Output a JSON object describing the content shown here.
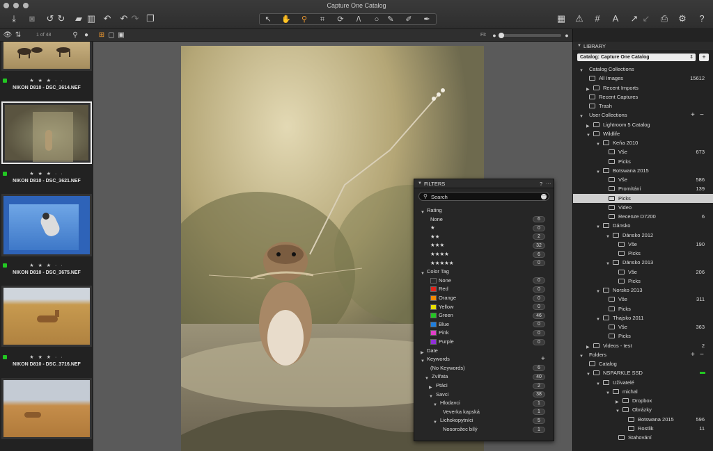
{
  "window": {
    "title": "Capture One Catalog"
  },
  "toolbar": {
    "fit_label": "Fit"
  },
  "browser": {
    "counter": "1 of 48",
    "thumbs": [
      {
        "stars": "★ ★ ★ · ·",
        "filename": "NIKON D810 - DSC_3614.NEF",
        "green": true
      },
      {
        "stars": "★ ★ ★ · ·",
        "filename": "NIKON D810 - DSC_3621.NEF",
        "green": true
      },
      {
        "stars": "★ ★ ★ · ·",
        "filename": "NIKON D810 - DSC_3675.NEF",
        "green": true
      },
      {
        "stars": "★ ★ ★ · ·",
        "filename": "NIKON D810 - DSC_3716.NEF",
        "green": true
      }
    ]
  },
  "filters": {
    "title": "FILTERS",
    "help": "?",
    "more": "···",
    "search_placeholder": "Search",
    "rating_header": "Rating",
    "ratings": [
      {
        "label": "None",
        "count": "6"
      },
      {
        "label": "★",
        "count": "0"
      },
      {
        "label": "★★",
        "count": "2"
      },
      {
        "label": "★★★",
        "count": "32"
      },
      {
        "label": "★★★★",
        "count": "6"
      },
      {
        "label": "★★★★★",
        "count": "0"
      }
    ],
    "colortag_header": "Color Tag",
    "colortags": [
      {
        "label": "None",
        "count": "0",
        "color": "#2a2a2a"
      },
      {
        "label": "Red",
        "count": "0",
        "color": "#e0241c"
      },
      {
        "label": "Orange",
        "count": "0",
        "color": "#f08a00"
      },
      {
        "label": "Yellow",
        "count": "0",
        "color": "#e8e000"
      },
      {
        "label": "Green",
        "count": "46",
        "color": "#22c822"
      },
      {
        "label": "Blue",
        "count": "0",
        "color": "#1e7fe0"
      },
      {
        "label": "Pink",
        "count": "0",
        "color": "#e040c8"
      },
      {
        "label": "Purple",
        "count": "0",
        "color": "#9030d8"
      }
    ],
    "date_header": "Date",
    "keywords_header": "Keywords",
    "keywords": [
      {
        "label": "(No Keywords)",
        "count": "6",
        "indent": 0,
        "arrow": ""
      },
      {
        "label": "Zvířata",
        "count": "40",
        "indent": 0,
        "arrow": "▼"
      },
      {
        "label": "Ptáci",
        "count": "2",
        "indent": 1,
        "arrow": "▶"
      },
      {
        "label": "Savci",
        "count": "38",
        "indent": 1,
        "arrow": "▼"
      },
      {
        "label": "Hlodavci",
        "count": "1",
        "indent": 2,
        "arrow": "▼"
      },
      {
        "label": "Veverka kapská",
        "count": "1",
        "indent": 3,
        "arrow": ""
      },
      {
        "label": "Lichokopytníci",
        "count": "5",
        "indent": 2,
        "arrow": "▼"
      },
      {
        "label": "Nosorožec bílý",
        "count": "1",
        "indent": 3,
        "arrow": ""
      }
    ]
  },
  "library": {
    "title": "LIBRARY",
    "catalog_select": "Catalog: Capture One Catalog",
    "add": "+",
    "rows": [
      {
        "label": "Catalog Collections",
        "indent": 0,
        "arrow": "▼",
        "count": "",
        "icon": false,
        "sel": false
      },
      {
        "label": "All Images",
        "indent": 1,
        "arrow": "",
        "count": "15612",
        "icon": true,
        "sel": false
      },
      {
        "label": "Recent Imports",
        "indent": 1,
        "arrow": "▶",
        "count": "",
        "icon": true,
        "sel": false
      },
      {
        "label": "Recent Captures",
        "indent": 1,
        "arrow": "",
        "count": "",
        "icon": true,
        "sel": false
      },
      {
        "label": "Trash",
        "indent": 1,
        "arrow": "",
        "count": "",
        "icon": true,
        "sel": false
      },
      {
        "label": "User Collections",
        "indent": 0,
        "arrow": "▼",
        "count": "",
        "icon": false,
        "sel": false,
        "plusminus": true
      },
      {
        "label": "Lightroom 5 Catalog",
        "indent": 1,
        "arrow": "▶",
        "count": "",
        "icon": true,
        "sel": false
      },
      {
        "label": "Wildlife",
        "indent": 1,
        "arrow": "▼",
        "count": "",
        "icon": true,
        "sel": false
      },
      {
        "label": "Keňa 2010",
        "indent": 2,
        "arrow": "▼",
        "count": "",
        "icon": true,
        "sel": false
      },
      {
        "label": "Vše",
        "indent": 3,
        "arrow": "",
        "count": "673",
        "icon": true,
        "sel": false
      },
      {
        "label": "Picks",
        "indent": 3,
        "arrow": "",
        "count": "",
        "icon": true,
        "sel": false
      },
      {
        "label": "Botswana 2015",
        "indent": 2,
        "arrow": "▼",
        "count": "",
        "icon": true,
        "sel": false
      },
      {
        "label": "Vše",
        "indent": 3,
        "arrow": "",
        "count": "586",
        "icon": true,
        "sel": false
      },
      {
        "label": "Promítání",
        "indent": 3,
        "arrow": "",
        "count": "139",
        "icon": true,
        "sel": false
      },
      {
        "label": "Picks",
        "indent": 3,
        "arrow": "",
        "count": "",
        "icon": true,
        "sel": true
      },
      {
        "label": "Video",
        "indent": 3,
        "arrow": "",
        "count": "",
        "icon": true,
        "sel": false
      },
      {
        "label": "Recenze D7200",
        "indent": 3,
        "arrow": "",
        "count": "6",
        "icon": true,
        "sel": false
      },
      {
        "label": "Dánsko",
        "indent": 2,
        "arrow": "▼",
        "count": "",
        "icon": true,
        "sel": false
      },
      {
        "label": "Dánsko 2012",
        "indent": 3,
        "arrow": "▼",
        "count": "",
        "icon": true,
        "sel": false
      },
      {
        "label": "Vše",
        "indent": 4,
        "arrow": "",
        "count": "190",
        "icon": true,
        "sel": false
      },
      {
        "label": "Picks",
        "indent": 4,
        "arrow": "",
        "count": "",
        "icon": true,
        "sel": false
      },
      {
        "label": "Dánsko 2013",
        "indent": 3,
        "arrow": "▼",
        "count": "",
        "icon": true,
        "sel": false
      },
      {
        "label": "Vše",
        "indent": 4,
        "arrow": "",
        "count": "206",
        "icon": true,
        "sel": false
      },
      {
        "label": "Picks",
        "indent": 4,
        "arrow": "",
        "count": "",
        "icon": true,
        "sel": false
      },
      {
        "label": "Norsko 2013",
        "indent": 2,
        "arrow": "▼",
        "count": "",
        "icon": true,
        "sel": false
      },
      {
        "label": "Vše",
        "indent": 3,
        "arrow": "",
        "count": "311",
        "icon": true,
        "sel": false
      },
      {
        "label": "Picks",
        "indent": 3,
        "arrow": "",
        "count": "",
        "icon": true,
        "sel": false
      },
      {
        "label": "Thajsko 2011",
        "indent": 2,
        "arrow": "▼",
        "count": "",
        "icon": true,
        "sel": false
      },
      {
        "label": "Vše",
        "indent": 3,
        "arrow": "",
        "count": "363",
        "icon": true,
        "sel": false
      },
      {
        "label": "Picks",
        "indent": 3,
        "arrow": "",
        "count": "",
        "icon": true,
        "sel": false
      },
      {
        "label": "Videos - test",
        "indent": 1,
        "arrow": "▶",
        "count": "2",
        "icon": true,
        "sel": false
      },
      {
        "label": "Folders",
        "indent": 0,
        "arrow": "▼",
        "count": "",
        "icon": false,
        "sel": false,
        "plusminus": true
      },
      {
        "label": "Catalog",
        "indent": 1,
        "arrow": "",
        "count": "",
        "icon": true,
        "sel": false
      },
      {
        "label": "NSPARKLE SSD",
        "indent": 1,
        "arrow": "▼",
        "count": "",
        "icon": true,
        "sel": false,
        "green": true
      },
      {
        "label": "Uživatelé",
        "indent": 2,
        "arrow": "▼",
        "count": "",
        "icon": true,
        "sel": false
      },
      {
        "label": "michal",
        "indent": 3,
        "arrow": "▼",
        "count": "",
        "icon": true,
        "sel": false
      },
      {
        "label": "Dropbox",
        "indent": 4,
        "arrow": "▶",
        "count": "",
        "icon": true,
        "sel": false
      },
      {
        "label": "Obrázky",
        "indent": 4,
        "arrow": "▼",
        "count": "",
        "icon": true,
        "sel": false
      },
      {
        "label": "Botswana 2015",
        "indent": 5,
        "arrow": "",
        "count": "596",
        "icon": true,
        "sel": false
      },
      {
        "label": "Rostlik",
        "indent": 5,
        "arrow": "",
        "count": "11",
        "icon": true,
        "sel": false
      },
      {
        "label": "Stahování",
        "indent": 4,
        "arrow": "",
        "count": "",
        "icon": true,
        "sel": false
      }
    ]
  }
}
